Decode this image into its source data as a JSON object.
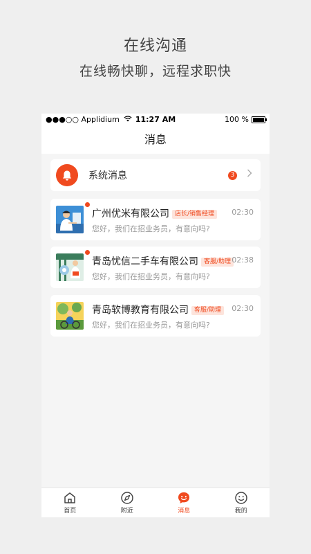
{
  "promo": {
    "title": "在线沟通",
    "subtitle": "在线畅快聊，远程求职快"
  },
  "status_bar": {
    "carrier": "●●●○○ Applidium",
    "time": "11:27 AM",
    "battery": "100 %"
  },
  "header": {
    "title": "消息"
  },
  "system_message": {
    "label": "系统消息",
    "badge_count": "3",
    "icon": "bell-icon"
  },
  "conversations": [
    {
      "company": "广州优米有限公司",
      "tag": "店长/销售经理",
      "time": "02:30",
      "preview": "您好，我们在招业务员，有意向吗?",
      "unread": true
    },
    {
      "company": "青岛忧信二手车有限公司",
      "tag": "客服/助理",
      "time": "02:38",
      "preview": "您好，我们在招业务员，有意向吗?",
      "unread": true
    },
    {
      "company": "青岛软博教育有限公司",
      "tag": "客服/助理",
      "time": "02:30",
      "preview": "您好，我们在招业务员，有意向吗?",
      "unread": false
    }
  ],
  "tabbar": {
    "items": [
      {
        "label": "首页",
        "icon": "home-icon"
      },
      {
        "label": "附近",
        "icon": "compass-icon"
      },
      {
        "label": "消息",
        "icon": "chat-icon",
        "active": true
      },
      {
        "label": "我的",
        "icon": "smiley-icon"
      }
    ]
  },
  "colors": {
    "accent": "#f04a1f",
    "background": "#efefef"
  }
}
